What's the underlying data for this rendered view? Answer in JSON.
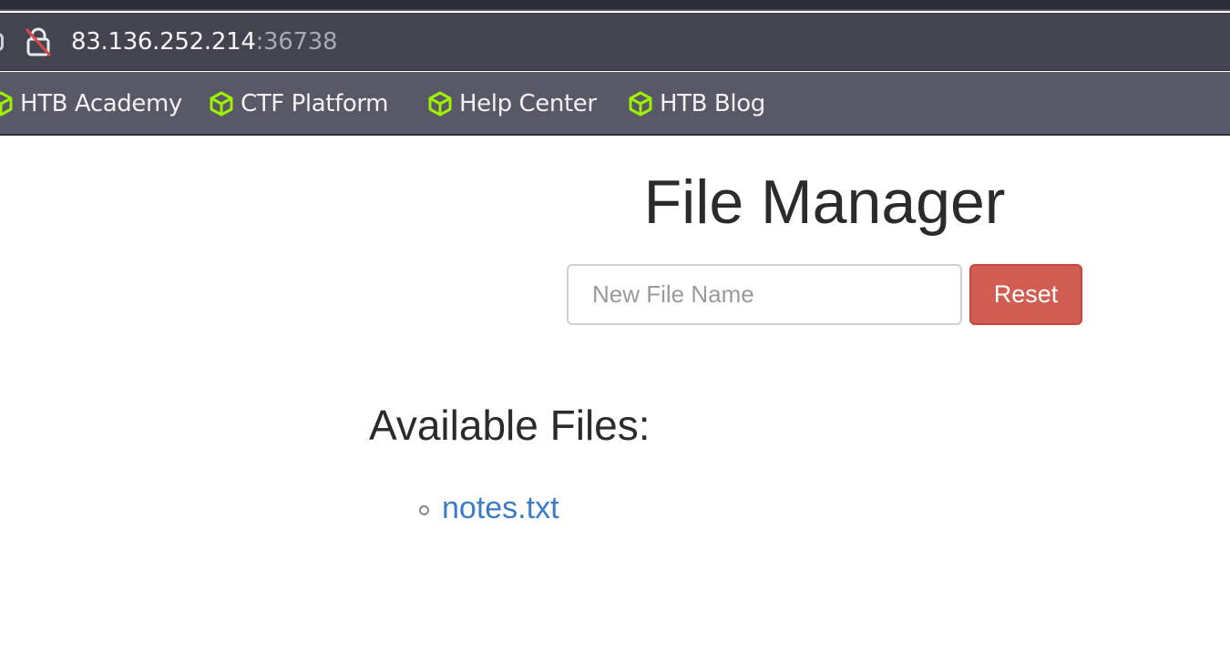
{
  "browser": {
    "url_host": "83.136.252.214",
    "url_port": ":36738",
    "bookmarks": [
      {
        "label": "HTB Academy",
        "icon": "cube-icon"
      },
      {
        "label": "CTF Platform",
        "icon": "cube-icon"
      },
      {
        "label": "Help Center",
        "icon": "cube-icon"
      },
      {
        "label": "HTB Blog",
        "icon": "cube-icon"
      }
    ],
    "bookmark_icon_color": "#9fef00"
  },
  "page": {
    "title": "File Manager",
    "new_file_placeholder": "New File Name",
    "reset_label": "Reset",
    "files_heading": "Available Files:",
    "files": [
      "notes.txt"
    ]
  }
}
